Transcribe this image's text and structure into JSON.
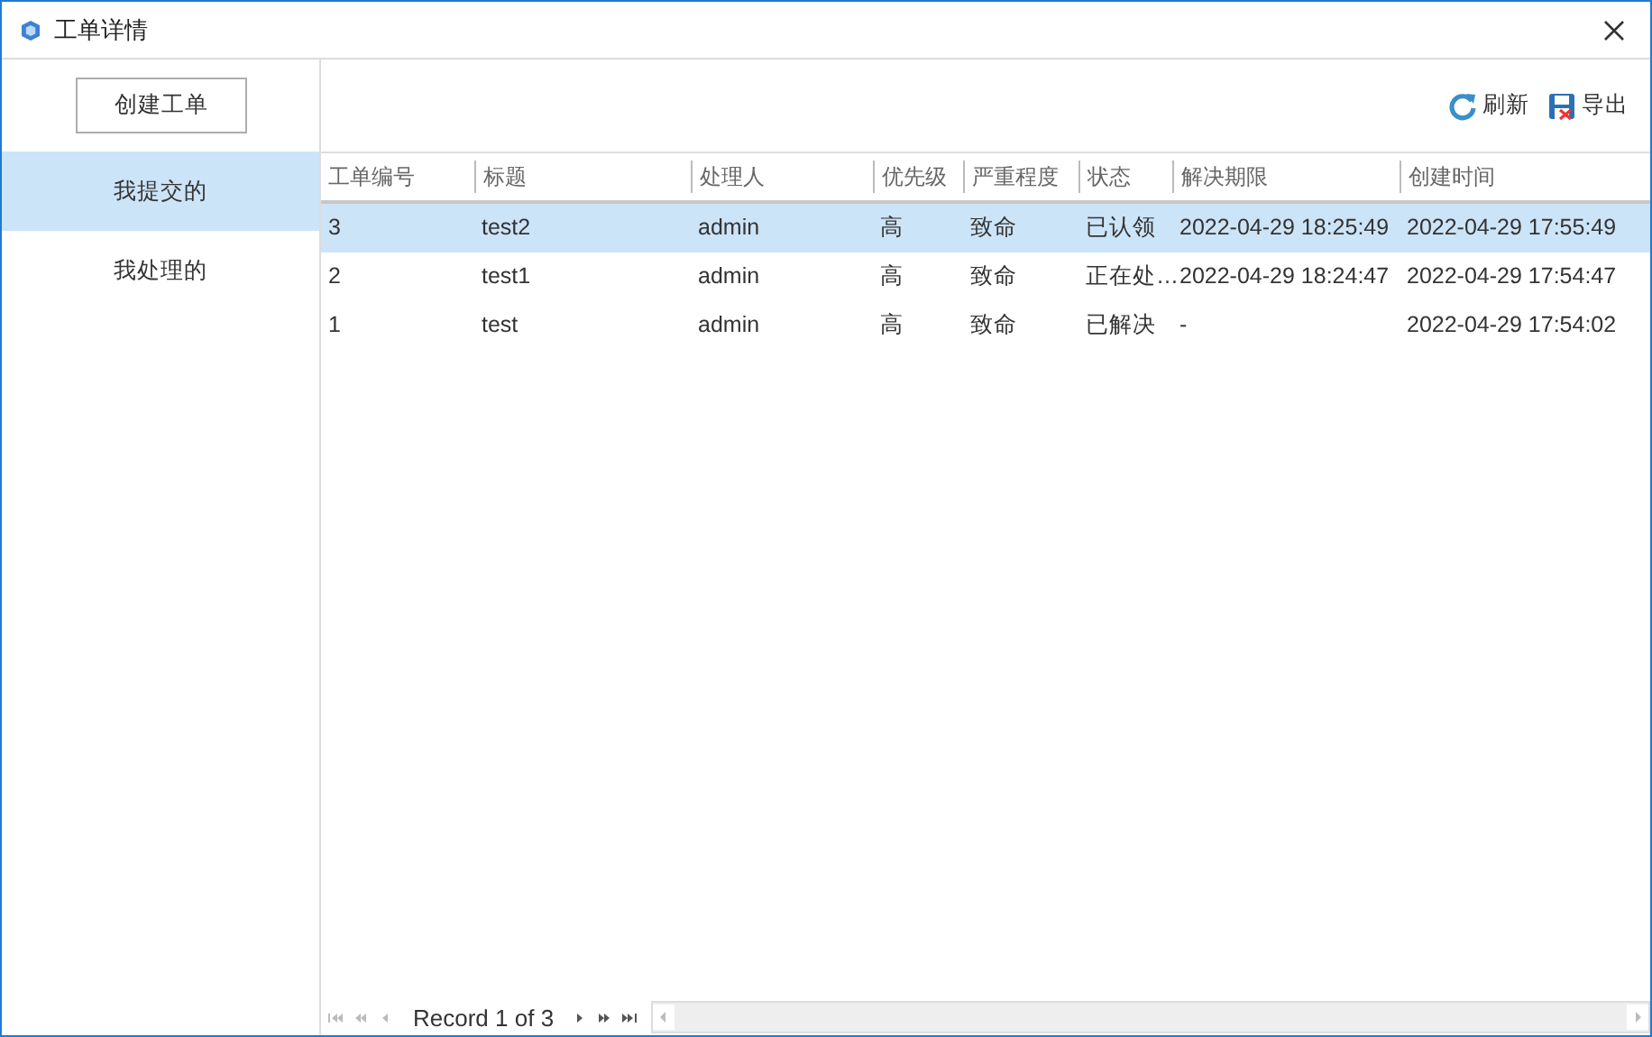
{
  "window": {
    "title": "工单详情"
  },
  "sidebar": {
    "create_button": "创建工单",
    "items": [
      {
        "label": "我提交的",
        "selected": true
      },
      {
        "label": "我处理的",
        "selected": false
      }
    ]
  },
  "toolbar": {
    "buttons": [
      {
        "kind": "refresh",
        "label": "刷新"
      },
      {
        "kind": "export",
        "label": "导出"
      }
    ]
  },
  "table": {
    "columns": [
      "工单编号",
      "标题",
      "处理人",
      "优先级",
      "严重程度",
      "状态",
      "解决期限",
      "创建时间"
    ],
    "rows": [
      {
        "selected": true,
        "cells": [
          "3",
          "test2",
          "admin",
          "高",
          "致命",
          "已认领",
          "2022-04-29 18:25:49",
          "2022-04-29 17:55:49"
        ]
      },
      {
        "selected": false,
        "cells": [
          "2",
          "test1",
          "admin",
          "高",
          "致命",
          "正在处…",
          "2022-04-29 18:24:47",
          "2022-04-29 17:54:47"
        ]
      },
      {
        "selected": false,
        "cells": [
          "1",
          "test",
          "admin",
          "高",
          "致命",
          "已解决",
          "-",
          "2022-04-29 17:54:02"
        ]
      }
    ]
  },
  "pager": {
    "text": "Record 1 of 3"
  }
}
